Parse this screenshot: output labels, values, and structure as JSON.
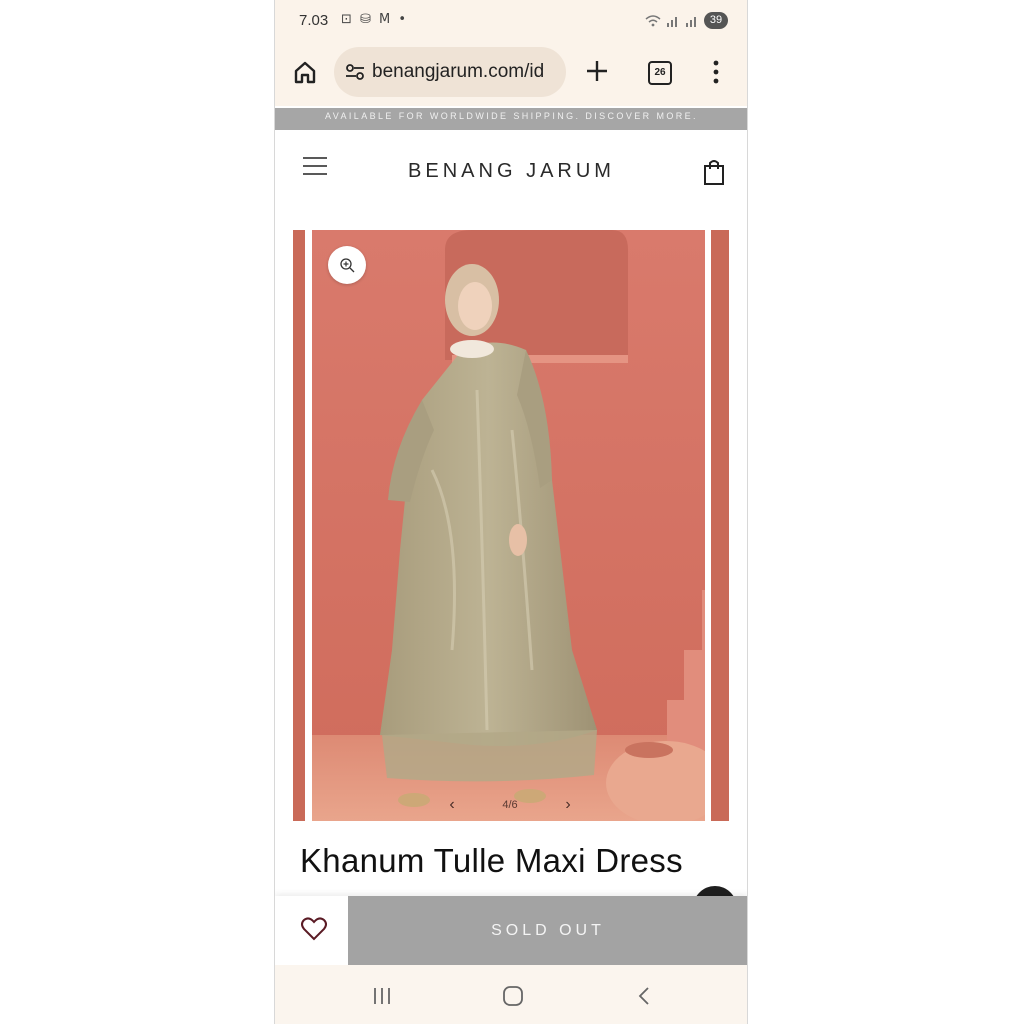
{
  "status_bar": {
    "time": "7.03",
    "left_icons": "⊡ ⛁ M •",
    "battery": "39"
  },
  "browser": {
    "url": "benangjarum.com/id",
    "tab_count": "26",
    "icons": [
      "home-icon",
      "site-settings-icon",
      "new-tab-icon",
      "tabs-icon",
      "more-vert-icon"
    ]
  },
  "announcement": "AVAILABLE FOR WORLDWIDE SHIPPING. DISCOVER MORE.",
  "header": {
    "brand": "BENANG JARUM",
    "icons": [
      "hamburger-menu-icon",
      "shopping-bag-icon"
    ]
  },
  "gallery": {
    "counter": "4/6",
    "icons": [
      "zoom-icon",
      "chevron-left-icon",
      "chevron-right-icon"
    ]
  },
  "product": {
    "title": "Khanum Tulle Maxi Dress",
    "status_label": "SOLD OUT"
  },
  "system_nav": {
    "icons": [
      "recent-apps-icon",
      "home-button-icon",
      "back-icon"
    ]
  },
  "colors": {
    "browser_bg": "#fbf3ea",
    "url_pill": "#efe3d6",
    "announcement_bg": "#a6a6a6",
    "soldout_bg": "#a3a3a3",
    "photo_wall": "#d9776a",
    "dress": "#b2a88a"
  }
}
